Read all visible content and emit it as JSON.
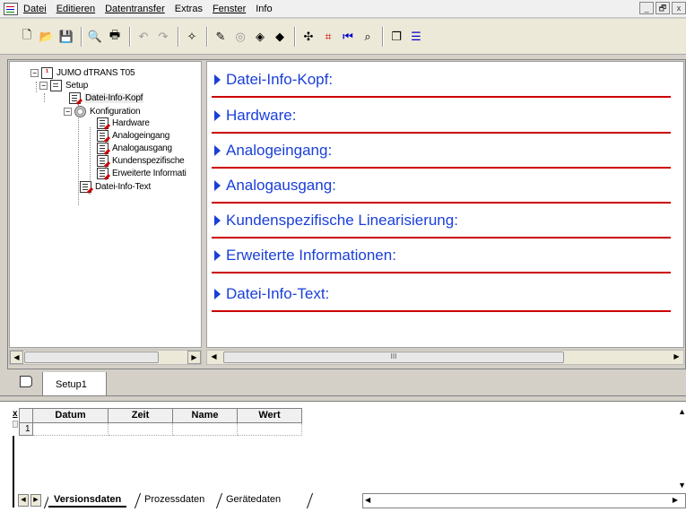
{
  "menu": {
    "items": [
      {
        "label": "Datei"
      },
      {
        "label": "Editieren"
      },
      {
        "label": "Datentransfer"
      },
      {
        "label": "Extras"
      },
      {
        "label": "Fenster"
      },
      {
        "label": "Info"
      }
    ],
    "window_controls": [
      "_",
      "🗗",
      "x"
    ]
  },
  "toolbar": {
    "buttons": [
      {
        "icon": "new-file-icon",
        "glyph": "🗋"
      },
      {
        "icon": "open-folder-icon",
        "glyph": "📂"
      },
      {
        "icon": "save-icon",
        "glyph": "💾"
      },
      {
        "icon": "print-preview-icon",
        "glyph": "🔍"
      },
      {
        "icon": "print-icon",
        "glyph": "🖶"
      },
      {
        "icon": "undo-icon",
        "glyph": "↶"
      },
      {
        "icon": "redo-icon",
        "glyph": "↷"
      },
      {
        "icon": "wand-icon",
        "glyph": "✧"
      },
      {
        "icon": "edit-icon",
        "glyph": "✎"
      },
      {
        "icon": "disk-icon",
        "glyph": "◎"
      },
      {
        "icon": "transfer-in-icon",
        "glyph": "◈"
      },
      {
        "icon": "transfer-out-icon",
        "glyph": "◆"
      },
      {
        "icon": "device-icon",
        "glyph": "✣"
      },
      {
        "icon": "chart-icon",
        "glyph": "⌗"
      },
      {
        "icon": "back-icon",
        "glyph": "⏮"
      },
      {
        "icon": "search-icon",
        "glyph": "⌕"
      },
      {
        "icon": "window-cascade-icon",
        "glyph": "❐"
      },
      {
        "icon": "window-split-icon",
        "glyph": "☰"
      }
    ]
  },
  "tree": {
    "root": "JUMO dTRANS T05",
    "setup": "Setup",
    "datei_info_kopf": "Datei-Info-Kopf",
    "konfiguration": "Konfiguration",
    "hardware": "Hardware",
    "analogeingang": "Analogeingang",
    "analogausgang": "Analogausgang",
    "kundenspezifische": "Kundenspezifische",
    "erweiterte": "Erweiterte Informati",
    "datei_info_text": "Datei-Info-Text"
  },
  "sections": [
    {
      "label": "Datei-Info-Kopf:"
    },
    {
      "label": "Hardware:"
    },
    {
      "label": "Analogeingang:"
    },
    {
      "label": "Analogausgang:"
    },
    {
      "label": "Kundenspezifische Linearisierung:"
    },
    {
      "label": "Erweiterte Informationen:"
    },
    {
      "label": "Datei-Info-Text:"
    }
  ],
  "colors": {
    "section_text": "#1a3fd8",
    "section_rule": "#cc0000"
  },
  "doc_tab": {
    "label": "Setup1"
  },
  "grid": {
    "close_label": "x",
    "headers": [
      "Datum",
      "Zeit",
      "Name",
      "Wert"
    ],
    "row_number": "1"
  },
  "sheet_tabs": [
    {
      "label": "Versionsdaten"
    },
    {
      "label": "Prozessdaten"
    },
    {
      "label": "Gerätedaten"
    }
  ],
  "scroll": {
    "thumb_grip": "III"
  }
}
